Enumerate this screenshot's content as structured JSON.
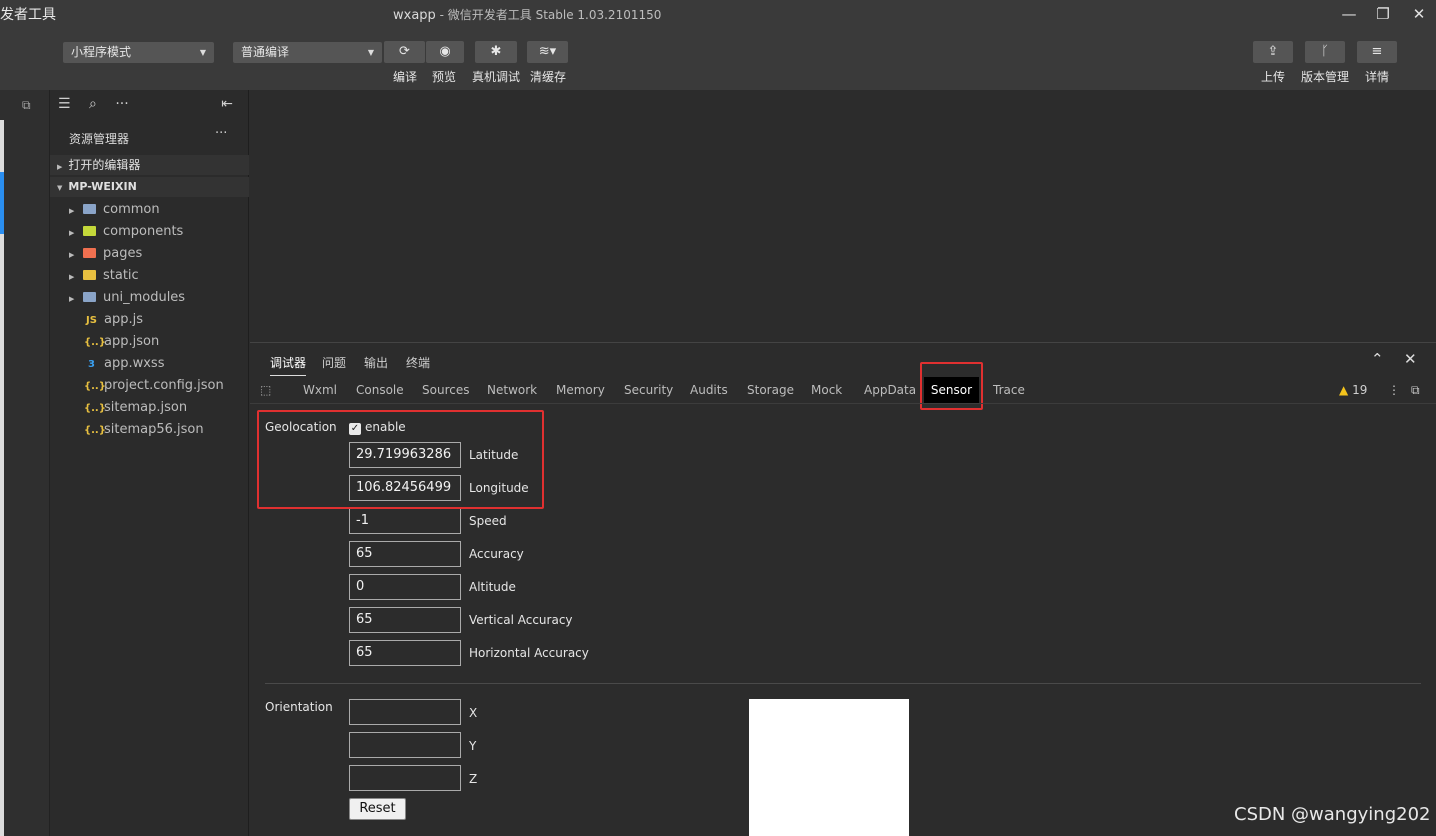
{
  "app": {
    "name_partial": "发者工具",
    "project": "wxapp",
    "title_rest": " - 微信开发者工具 Stable 1.03.2101150"
  },
  "window_controls": {
    "minimize": "—",
    "maximize": "❐",
    "close": "✕"
  },
  "toolbar": {
    "mode_select": "小程序模式",
    "compile_select": "普通编译",
    "compile": "编译",
    "preview": "预览",
    "real_debug": "真机调试",
    "clear_cache": "清缓存",
    "upload": "上传",
    "version": "版本管理",
    "details": "详情"
  },
  "explorer": {
    "title": "资源管理器",
    "more": "···",
    "open_editors": "打开的编辑器",
    "project_root": "MP-WEIXIN",
    "folders": [
      {
        "name": "common",
        "color": "#8aa4c8"
      },
      {
        "name": "components",
        "color": "#c4d83a"
      },
      {
        "name": "pages",
        "color": "#f07050"
      },
      {
        "name": "static",
        "color": "#e8c040"
      },
      {
        "name": "uni_modules",
        "color": "#8aa4c8"
      }
    ],
    "files": [
      {
        "name": "app.js",
        "icon": "JS",
        "color": "#e8c040"
      },
      {
        "name": "app.json",
        "icon": "{..}",
        "color": "#e8c040"
      },
      {
        "name": "app.wxss",
        "icon": "3",
        "color": "#3aa0f0"
      },
      {
        "name": "project.config.json",
        "icon": "{..}",
        "color": "#e8c040"
      },
      {
        "name": "sitemap.json",
        "icon": "{..}",
        "color": "#e8c040"
      },
      {
        "name": "sitemap56.json",
        "icon": "{..}",
        "color": "#e8c040"
      }
    ]
  },
  "devtools": {
    "tabs": [
      "调试器",
      "问题",
      "输出",
      "终端"
    ],
    "panels": [
      "Wxml",
      "Console",
      "Sources",
      "Network",
      "Memory",
      "Security",
      "Audits",
      "Storage",
      "Mock",
      "AppData",
      "Sensor",
      "Trace"
    ],
    "active_panel": "Sensor",
    "warnings": "19"
  },
  "sensor": {
    "geolocation_label": "Geolocation",
    "enable_label": "enable",
    "enabled": true,
    "fields": [
      {
        "value": "29.719963286",
        "label": "Latitude"
      },
      {
        "value": "106.82456499",
        "label": "Longitude"
      },
      {
        "value": "-1",
        "label": "Speed"
      },
      {
        "value": "65",
        "label": "Accuracy"
      },
      {
        "value": "0",
        "label": "Altitude"
      },
      {
        "value": "65",
        "label": "Vertical Accuracy"
      },
      {
        "value": "65",
        "label": "Horizontal Accuracy"
      }
    ],
    "orientation_label": "Orientation",
    "orientation_fields": [
      {
        "value": "",
        "label": "X"
      },
      {
        "value": "",
        "label": "Y"
      },
      {
        "value": "",
        "label": "Z"
      }
    ],
    "reset_label": "Reset"
  },
  "watermark": "CSDN @wangying202",
  "colors": {
    "highlight": "#e03030",
    "accent_blue": "#2a8ef0"
  }
}
